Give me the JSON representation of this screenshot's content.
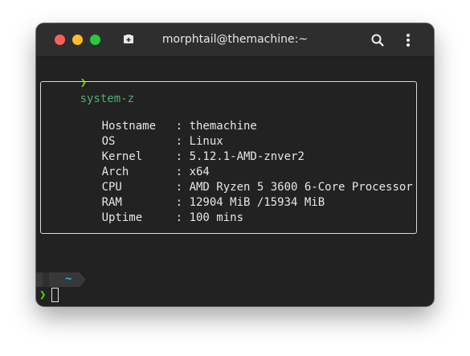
{
  "window": {
    "title": "morphtail@themachine:~"
  },
  "terminal": {
    "prompt_symbol": "❯",
    "command": "system-z",
    "info": [
      {
        "key": "Hostname",
        "sep": ":",
        "value": "themachine"
      },
      {
        "key": "OS",
        "sep": ":",
        "value": "Linux"
      },
      {
        "key": "Kernel",
        "sep": ":",
        "value": "5.12.1-AMD-znver2"
      },
      {
        "key": "Arch",
        "sep": ":",
        "value": "x64"
      },
      {
        "key": "CPU",
        "sep": ":",
        "value": "AMD Ryzen 5 3600 6-Core Processor"
      },
      {
        "key": "RAM",
        "sep": ":",
        "value": "12904 MiB /15934 MiB"
      },
      {
        "key": "Uptime",
        "sep": ":",
        "value": "100 mins"
      }
    ],
    "cwd": "~"
  },
  "colors": {
    "close": "#ff5f57",
    "minimize": "#febc2e",
    "maximize": "#28c840",
    "prompt_green": "#5fd700",
    "command_green": "#4caf7a",
    "cwd_blue": "#2aa8ff"
  },
  "icons": {
    "new_tab": "new-tab-icon",
    "search": "search-icon",
    "menu": "kebab-menu-icon"
  }
}
